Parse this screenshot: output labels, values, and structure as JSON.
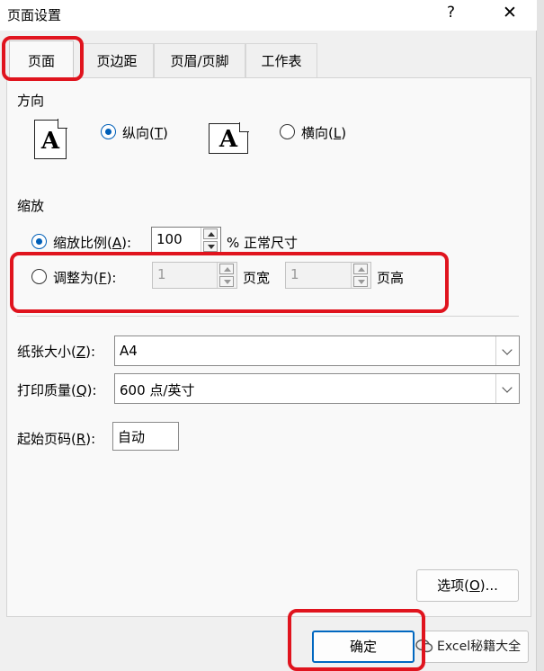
{
  "window": {
    "title": "页面设置",
    "help": "?",
    "close": "✕"
  },
  "tabs": [
    {
      "label": "页面",
      "active": true
    },
    {
      "label": "页边距"
    },
    {
      "label": "页眉/页脚"
    },
    {
      "label": "工作表"
    }
  ],
  "orientation": {
    "heading": "方向",
    "icon_letter": "A",
    "portrait": {
      "label": "纵向(",
      "key": "T",
      "end": ")",
      "checked": true
    },
    "landscape": {
      "label": "横向(",
      "key": "L",
      "end": ")",
      "checked": false
    }
  },
  "scaling": {
    "heading": "缩放",
    "adjust": {
      "label": "缩放比例(",
      "key": "A",
      "end": "):",
      "value": "100",
      "suffix": "% 正常尺寸",
      "checked": true
    },
    "fit": {
      "label": "调整为(",
      "key": "F",
      "end": "):",
      "wide_value": "1",
      "wide_suffix": "页宽",
      "tall_value": "1",
      "tall_suffix": "页高",
      "checked": false
    }
  },
  "paper_size": {
    "label": "纸张大小(",
    "key": "Z",
    "end": "):",
    "value": "A4"
  },
  "print_quality": {
    "label": "打印质量(",
    "key": "Q",
    "end": "):",
    "value": "600 点/英寸"
  },
  "first_page": {
    "label": "起始页码(",
    "key": "R",
    "end": "):",
    "value": "自动"
  },
  "buttons": {
    "options": {
      "label": "选项(",
      "key": "O",
      "end": ")..."
    },
    "ok": "确定"
  },
  "watermark": "Excel秘籍大全",
  "colors": {
    "accent": "#005fb8",
    "highlight": "#e0141e"
  }
}
